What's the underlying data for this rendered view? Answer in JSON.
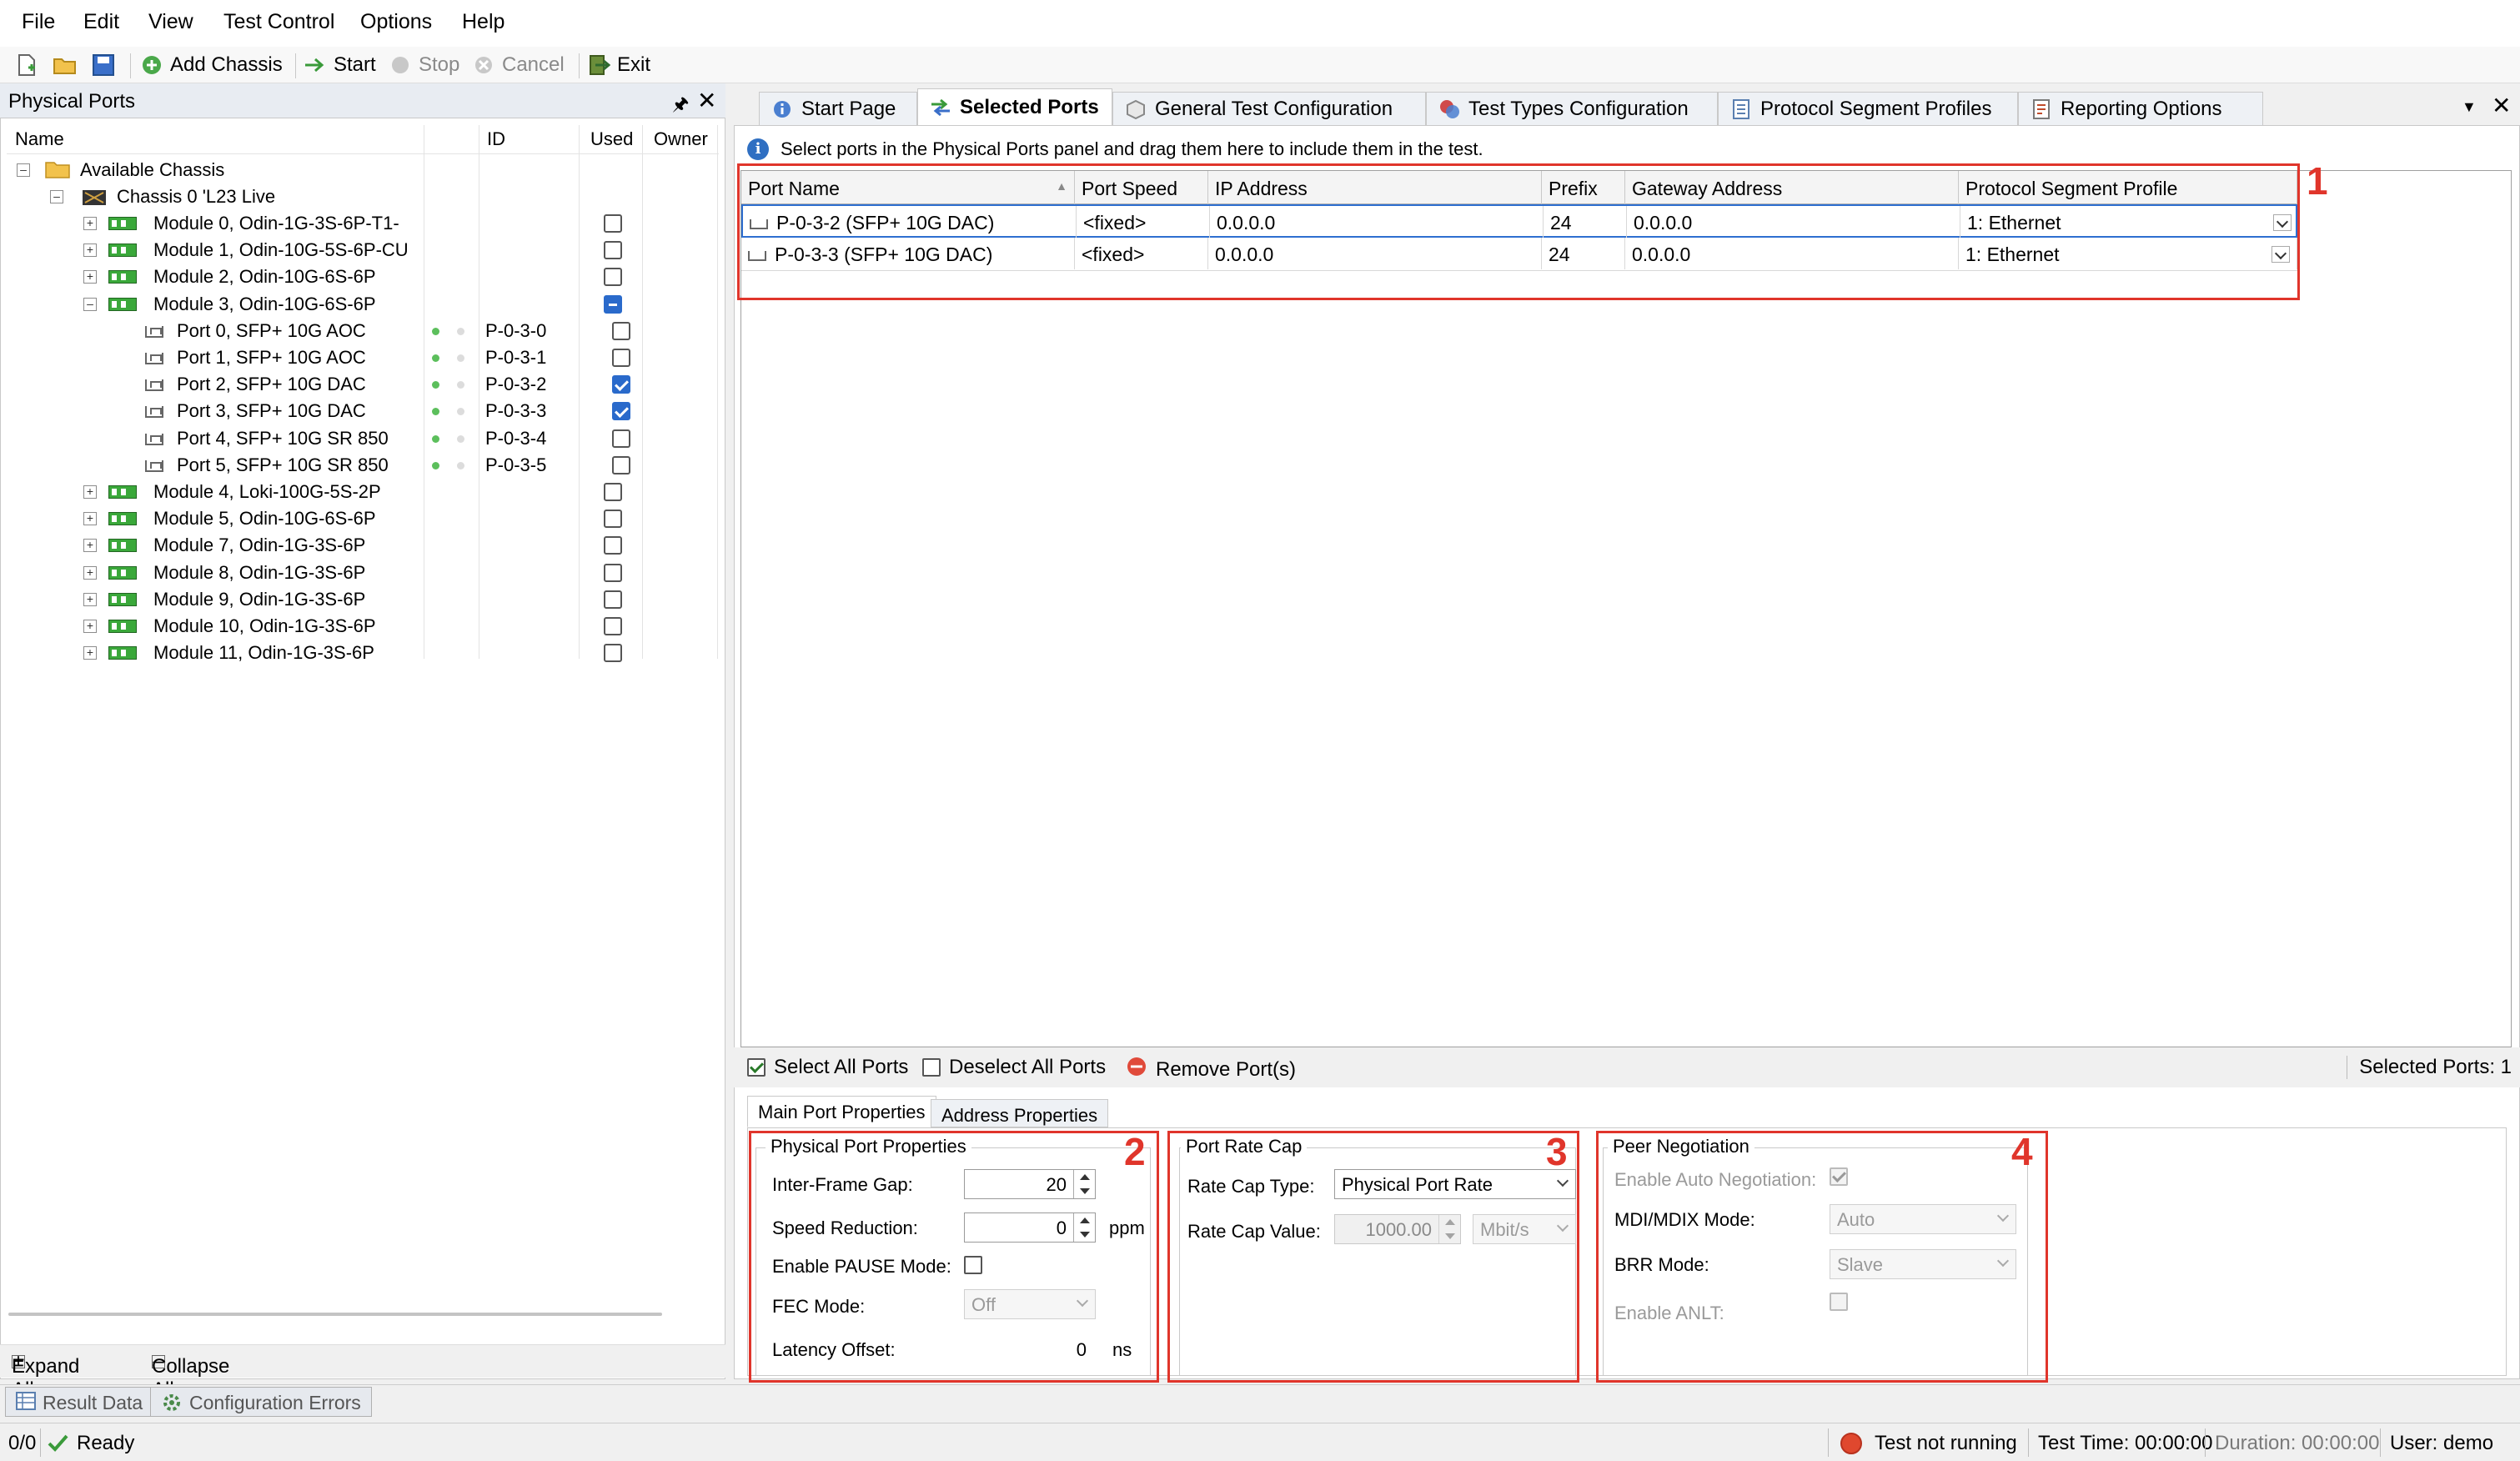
{
  "menu": [
    "File",
    "Edit",
    "View",
    "Test Control",
    "Options",
    "Help"
  ],
  "toolbar": {
    "add_chassis": "Add Chassis",
    "start": "Start",
    "stop": "Stop",
    "cancel": "Cancel",
    "exit": "Exit"
  },
  "physical_ports": {
    "title": "Physical Ports",
    "columns": [
      "Name",
      "ID",
      "Used",
      "Owner"
    ],
    "root": "Available Chassis",
    "chassis": "Chassis 0 'L23 Live",
    "modules_before": [
      {
        "label": "Module 0, Odin-1G-3S-6P-T1-"
      },
      {
        "label": "Module 1, Odin-10G-5S-6P-CU"
      },
      {
        "label": "Module 2, Odin-10G-6S-6P"
      }
    ],
    "expanded_module": {
      "label": "Module 3, Odin-10G-6S-6P"
    },
    "ports": [
      {
        "label": "Port 0, SFP+ 10G AOC",
        "id": "P-0-3-0",
        "used": false
      },
      {
        "label": "Port 1, SFP+ 10G AOC",
        "id": "P-0-3-1",
        "used": false
      },
      {
        "label": "Port 2, SFP+ 10G DAC",
        "id": "P-0-3-2",
        "used": true
      },
      {
        "label": "Port 3, SFP+ 10G DAC",
        "id": "P-0-3-3",
        "used": true
      },
      {
        "label": "Port 4, SFP+ 10G SR 850",
        "id": "P-0-3-4",
        "used": false
      },
      {
        "label": "Port 5, SFP+ 10G SR 850",
        "id": "P-0-3-5",
        "used": false
      }
    ],
    "modules_after": [
      {
        "label": "Module 4, Loki-100G-5S-2P"
      },
      {
        "label": "Module 5, Odin-10G-6S-6P"
      },
      {
        "label": "Module 7, Odin-1G-3S-6P"
      },
      {
        "label": "Module 8, Odin-1G-3S-6P"
      },
      {
        "label": "Module 9, Odin-1G-3S-6P"
      },
      {
        "label": "Module 10, Odin-1G-3S-6P"
      },
      {
        "label": "Module 11, Odin-1G-3S-6P"
      }
    ],
    "expand_all": "Expand All",
    "collapse_all": "Collapse All"
  },
  "tabs": [
    "Start Page",
    "Selected Ports",
    "General Test Configuration",
    "Test Types Configuration",
    "Protocol Segment Profiles",
    "Reporting Options"
  ],
  "info": "Select ports in the Physical Ports panel and drag them here to include them in the test.",
  "grid": {
    "columns": [
      "Port Name",
      "Port Speed",
      "IP Address",
      "Prefix",
      "Gateway Address",
      "Protocol Segment Profile"
    ],
    "rows": [
      [
        "P-0-3-2 (SFP+ 10G DAC)",
        "<fixed>",
        "0.0.0.0",
        "24",
        "0.0.0.0",
        "1: Ethernet"
      ],
      [
        "P-0-3-3 (SFP+ 10G DAC)",
        "<fixed>",
        "0.0.0.0",
        "24",
        "0.0.0.0",
        "1: Ethernet"
      ]
    ]
  },
  "annotations": [
    "1",
    "2",
    "3",
    "4"
  ],
  "actions": {
    "select_all": "Select All Ports",
    "deselect_all": "Deselect All Ports",
    "remove": "Remove Port(s)",
    "selected_count": "Selected Ports: 1"
  },
  "subtabs": [
    "Main Port Properties",
    "Address Properties"
  ],
  "physical_props": {
    "title": "Physical Port Properties",
    "ifg_label": "Inter-Frame Gap:",
    "ifg_value": "20",
    "speed_red_label": "Speed Reduction:",
    "speed_red_value": "0",
    "speed_red_unit": "ppm",
    "pause_label": "Enable PAUSE Mode:",
    "fec_label": "FEC Mode:",
    "fec_value": "Off",
    "latency_label": "Latency Offset:",
    "latency_value": "0",
    "latency_unit": "ns"
  },
  "rate_cap": {
    "title": "Port Rate Cap",
    "type_label": "Rate Cap Type:",
    "type_value": "Physical Port Rate",
    "value_label": "Rate Cap Value:",
    "value": "1000.00",
    "unit": "Mbit/s"
  },
  "peer": {
    "title": "Peer Negotiation",
    "auto_neg_label": "Enable Auto Negotiation:",
    "mdi_label": "MDI/MDIX Mode:",
    "mdi_value": "Auto",
    "brr_label": "BRR Mode:",
    "brr_value": "Slave",
    "anlt_label": "Enable ANLT:"
  },
  "bottom_tabs": [
    "Result Data",
    "Configuration Errors"
  ],
  "status": {
    "counter": "0/0",
    "ready": "Ready",
    "test_state": "Test not running",
    "test_time": "Test Time: 00:00:00",
    "duration": "Duration: 00:00:00",
    "user": "User: demo"
  },
  "colors": {
    "annotation_red": "#e0352b",
    "selection_blue": "#2e6fd0",
    "check_blue": "#2a6acb"
  }
}
